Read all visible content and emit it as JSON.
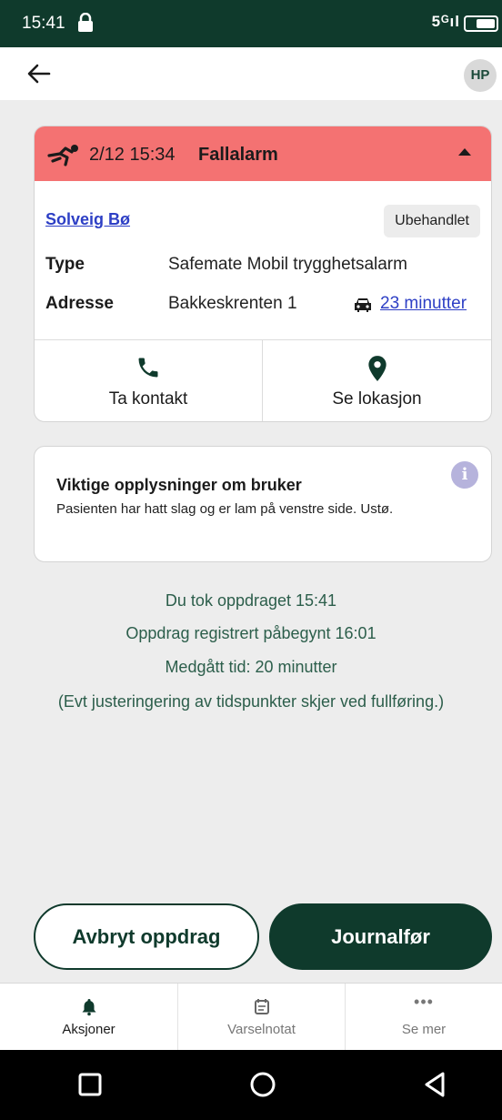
{
  "status_bar": {
    "time": "15:41",
    "signal": "5ᴳıl"
  },
  "header": {
    "avatar_initials": "HP"
  },
  "alarm": {
    "datetime": "2/12 15:34",
    "type": "Fallalarm",
    "person_name": "Solveig Bø",
    "status": "Ubehandlet",
    "type_label": "Type",
    "type_value": "Safemate Mobil trygghetsalarm",
    "address_label": "Adresse",
    "address_value": "Bakkeskrenten 1",
    "travel_time": "23 minutter",
    "contact_label": "Ta kontakt",
    "location_label": "Se lokasjon"
  },
  "info": {
    "title": "Viktige opplysninger om bruker",
    "text": "Pasienten har hatt slag og er lam på venstre side. Ustø."
  },
  "task": {
    "line1": "Du tok oppdraget 15:41",
    "line2": "Oppdrag registrert påbegynt 16:01",
    "line3": "Medgått tid: 20 minutter",
    "line4": "(Evt justeringering av tidspunkter skjer ved fullføring.)"
  },
  "buttons": {
    "cancel": "Avbryt oppdrag",
    "journal": "Journalfør"
  },
  "nav": {
    "actions": "Aksjoner",
    "notice": "Varselnotat",
    "more": "Se mer",
    "more_icon": "•••"
  },
  "colors": {
    "dark_green": "#0f3a2c",
    "alarm_red": "#f47272",
    "link_blue": "#2d3fc5",
    "info_green": "#2c5e4b"
  }
}
